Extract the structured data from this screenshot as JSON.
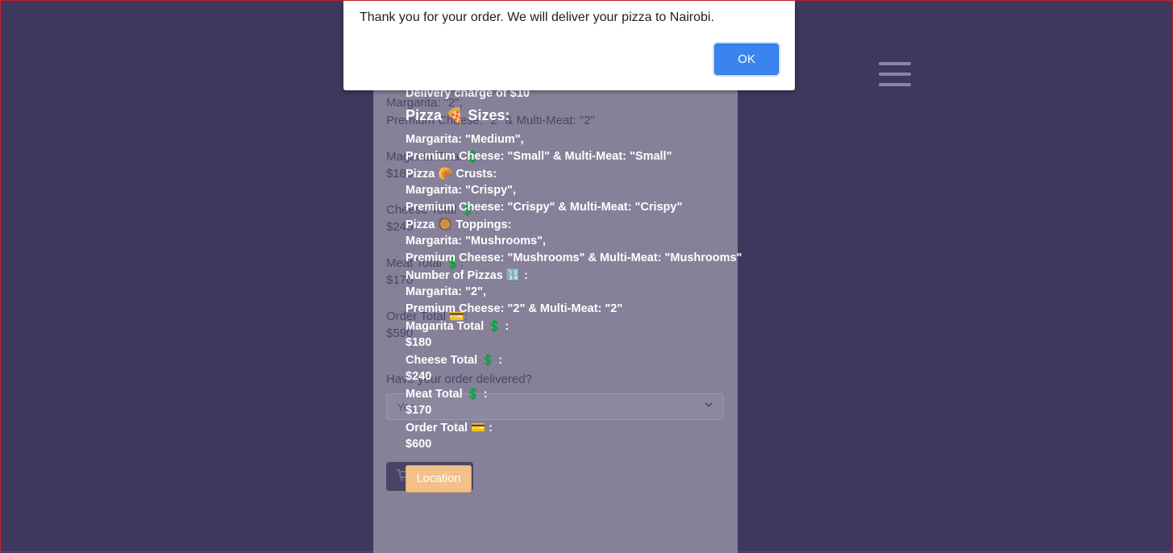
{
  "alert": {
    "message": "Thank you for your order. We will deliver your pizza to Nairobi.",
    "ok_label": "OK"
  },
  "background": {
    "lines": [
      "Margarita: \"2\",",
      "Premium Cheese: \"2\" & Multi-Meat: \"2\"",
      "Magarita Total 💲:",
      "$180",
      "Cheese Total 💲:",
      "$240",
      "Meat Total 💲:",
      "$170",
      "Order Total 💳:",
      "$590"
    ],
    "delivery_question": "Have your order delivered?",
    "delivery_select_value": "Yes",
    "cart_button_icon": "cart-icon"
  },
  "summary": {
    "delivery_charge": "Delivery charge of $10",
    "sizes_heading": "Pizza 🍕 Sizes:",
    "sizes_line1": "Margarita: \"Medium\",",
    "sizes_line2": "Premium Cheese: \"Small\" & Multi-Meat: \"Small\"",
    "crusts_heading": "Pizza 🥐 Crusts:",
    "crusts_line1": "Margarita: \"Crispy\",",
    "crusts_line2": "Premium Cheese: \"Crispy\" & Multi-Meat: \"Crispy\"",
    "toppings_heading": "Pizza 🥘 Toppings:",
    "toppings_line1": "Margarita: \"Mushrooms\",",
    "toppings_line2": "Premium Cheese: \"Mushrooms\" & Multi-Meat: \"Mushrooms\"",
    "number_heading": "Number of Pizzas 🔢 :",
    "number_line1": "Margarita: \"2\",",
    "number_line2": "Premium Cheese: \"2\" & Multi-Meat: \"2\"",
    "magarita_total_label": "Magarita Total 💲 :",
    "magarita_total_value": "$180",
    "cheese_total_label": "Cheese Total 💲 :",
    "cheese_total_value": "$240",
    "meat_total_label": "Meat Total 💲 :",
    "meat_total_value": "$170",
    "order_total_label": "Order Total 💳 :",
    "order_total_value": "$600",
    "location_button": "Location"
  },
  "nav": {
    "menu_icon": "hamburger-menu-icon"
  },
  "colors": {
    "page_bg": "#40375f",
    "panel_bg": "#878099",
    "accent_ok": "#3b84f0",
    "location_button": "#f1c187"
  }
}
